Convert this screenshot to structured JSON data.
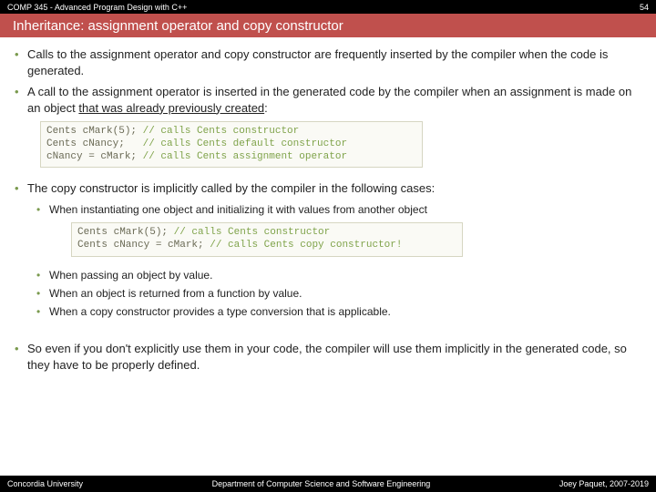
{
  "header": {
    "course": "COMP 345 - Advanced Program Design with C++",
    "page": "54"
  },
  "title": "Inheritance: assignment operator and copy constructor",
  "bul1": "Calls to the assignment operator and copy constructor are frequently inserted by the compiler when the code is generated.",
  "bul2_a": "A call to the assignment operator is inserted in the generated code by the compiler when an assignment is made on an object ",
  "bul2_b": "that was already previously created",
  "bul2_c": ":",
  "code1": {
    "l1a": "Cents cMark(5); ",
    "l1b": "// calls Cents constructor",
    "l2a": "Cents cNancy;   ",
    "l2b": "// calls Cents default constructor",
    "l3a": "cNancy = cMark; ",
    "l3b": "// calls Cents assignment operator"
  },
  "bul3": "The copy constructor is implicitly called by the compiler in the following cases:",
  "sub1": "When instantiating one object and initializing it with values from another object",
  "code2": {
    "l1a": "Cents cMark(5); ",
    "l1b": "// calls Cents constructor",
    "l2a": "Cents cNancy = cMark; ",
    "l2b": "// calls Cents copy constructor!"
  },
  "sub2": "When passing an object by value.",
  "sub3": "When an object is returned from a function by value.",
  "sub4": "When a copy constructor provides a type conversion that is applicable.",
  "bul4": "So even if you don't explicitly use them in your code, the compiler will use them implicitly in the generated code, so they have to be properly defined.",
  "footer": {
    "left": "Concordia University",
    "mid": "Department of Computer Science and Software Engineering",
    "right": "Joey Paquet, 2007-2019"
  }
}
